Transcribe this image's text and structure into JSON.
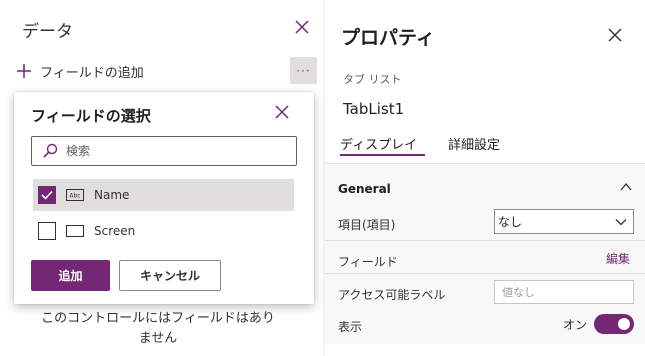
{
  "data_panel": {
    "title": "データ",
    "add_field_label": "フィールドの追加",
    "more_label": "···",
    "empty_message": "このコントロールにはフィールドはありません"
  },
  "flyout": {
    "title": "フィールドの選択",
    "search_placeholder": "検索",
    "fields": [
      {
        "label": "Name",
        "checked": true,
        "type_icon": "text-abc-icon"
      },
      {
        "label": "Screen",
        "checked": false,
        "type_icon": "screen-icon"
      }
    ],
    "add_label": "追加",
    "cancel_label": "キャンセル"
  },
  "properties": {
    "title": "プロパティ",
    "control_type": "タブ リスト",
    "control_name": "TabList1",
    "tabs": [
      {
        "label": "ディスプレイ",
        "active": true
      },
      {
        "label": "詳細設定",
        "active": false
      }
    ],
    "section_title": "General",
    "items_label": "項目(項目)",
    "items_value": "なし",
    "fields_label": "フィールド",
    "fields_edit": "編集",
    "accessible_label": "アクセス可能ラベル",
    "accessible_placeholder": "値なし",
    "visible_label": "表示",
    "visible_state": "オン"
  },
  "colors": {
    "accent": "#742774",
    "panel_bg": "#ffffff",
    "app_bg": "#f3f2f1"
  }
}
